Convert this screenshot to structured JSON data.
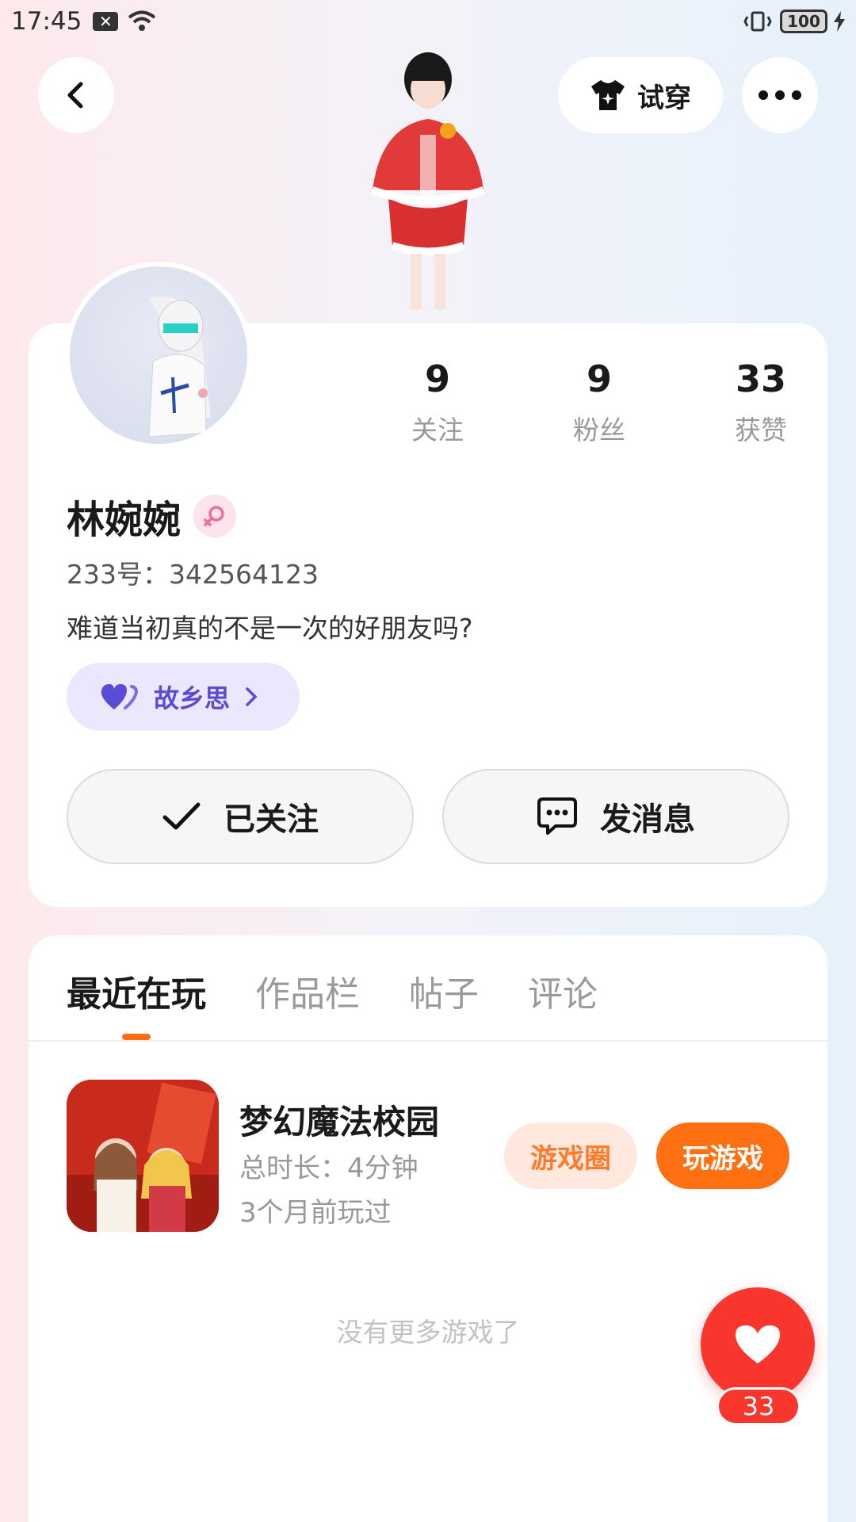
{
  "status_bar": {
    "time": "17:45",
    "battery": "100"
  },
  "header": {
    "try_on_label": "试穿"
  },
  "stats": [
    {
      "value": "9",
      "label": "关注"
    },
    {
      "value": "9",
      "label": "粉丝"
    },
    {
      "value": "33",
      "label": "获赞"
    }
  ],
  "profile": {
    "name": "林婉婉",
    "uid": "233号：342564123",
    "bio": "难道当初真的不是一次的好朋友吗?",
    "tag_label": "故乡思"
  },
  "actions": {
    "follow_label": "已关注",
    "message_label": "发消息"
  },
  "tabs": [
    {
      "label": "最近在玩",
      "active": true
    },
    {
      "label": "作品栏",
      "active": false
    },
    {
      "label": "帖子",
      "active": false
    },
    {
      "label": "评论",
      "active": false
    }
  ],
  "game": {
    "title": "梦幻魔法校园",
    "total_time": "总时长：4分钟",
    "last_played": "3个月前玩过",
    "circle_label": "游戏圈",
    "play_label": "玩游戏"
  },
  "no_more_text": "没有更多游戏了",
  "like": {
    "count": "33"
  },
  "colors": {
    "accent_orange": "#ff7013",
    "like_red": "#f9362e",
    "tag_purple": "#5a4bd6"
  }
}
